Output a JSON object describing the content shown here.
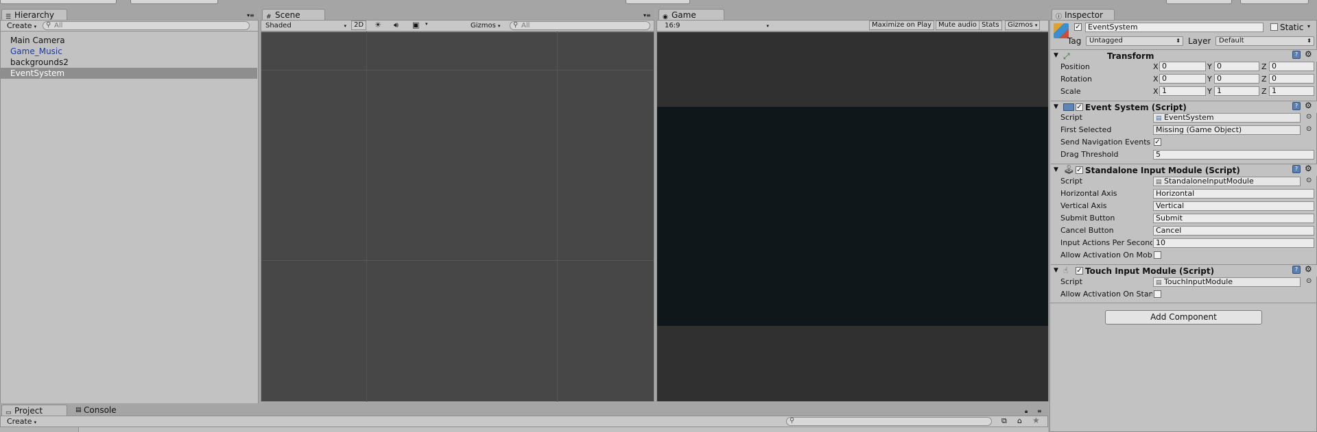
{
  "hierarchy": {
    "tab": "Hierarchy",
    "create": "Create",
    "search_placeholder": "All",
    "items": [
      {
        "label": "Main Camera"
      },
      {
        "label": "Game_Music"
      },
      {
        "label": "backgrounds2"
      },
      {
        "label": "EventSystem"
      }
    ]
  },
  "scene": {
    "tab": "Scene",
    "shading": "Shaded",
    "mode_2d": "2D",
    "gizmos": "Gizmos",
    "search_placeholder": "All"
  },
  "game": {
    "tab": "Game",
    "aspect": "16:9",
    "maximize": "Maximize on Play",
    "mute": "Mute audio",
    "stats": "Stats",
    "gizmos": "Gizmos"
  },
  "inspector": {
    "tab": "Inspector",
    "object_name": "EventSystem",
    "static_label": "Static",
    "tag_label": "Tag",
    "tag_value": "Untagged",
    "layer_label": "Layer",
    "layer_value": "Default",
    "transform": {
      "title": "Transform",
      "position": {
        "label": "Position",
        "x": "0",
        "y": "0",
        "z": "0"
      },
      "rotation": {
        "label": "Rotation",
        "x": "0",
        "y": "0",
        "z": "0"
      },
      "scale": {
        "label": "Scale",
        "x": "1",
        "y": "1",
        "z": "1"
      },
      "axis_x": "X",
      "axis_y": "Y",
      "axis_z": "Z"
    },
    "event_system": {
      "title": "Event System (Script)",
      "script_label": "Script",
      "script_value": "EventSystem",
      "first_selected_label": "First Selected",
      "first_selected_value": "Missing (Game Object)",
      "send_nav_label": "Send Navigation Events",
      "drag_threshold_label": "Drag Threshold",
      "drag_threshold_value": "5"
    },
    "standalone": {
      "title": "Standalone Input Module (Script)",
      "script_label": "Script",
      "script_value": "StandaloneInputModule",
      "horizontal_label": "Horizontal Axis",
      "horizontal_value": "Horizontal",
      "vertical_label": "Vertical Axis",
      "vertical_value": "Vertical",
      "submit_label": "Submit Button",
      "submit_value": "Submit",
      "cancel_label": "Cancel Button",
      "cancel_value": "Cancel",
      "input_actions_label": "Input Actions Per Second",
      "input_actions_value": "10",
      "allow_label": "Allow Activation On Mobile Device"
    },
    "touch": {
      "title": "Touch Input Module (Script)",
      "script_label": "Script",
      "script_value": "TouchInputModule",
      "allow_label": "Allow Activation On Standalone"
    },
    "add_component": "Add Component"
  },
  "bottom": {
    "project_tab": "Project",
    "console_tab": "Console",
    "create": "Create"
  }
}
